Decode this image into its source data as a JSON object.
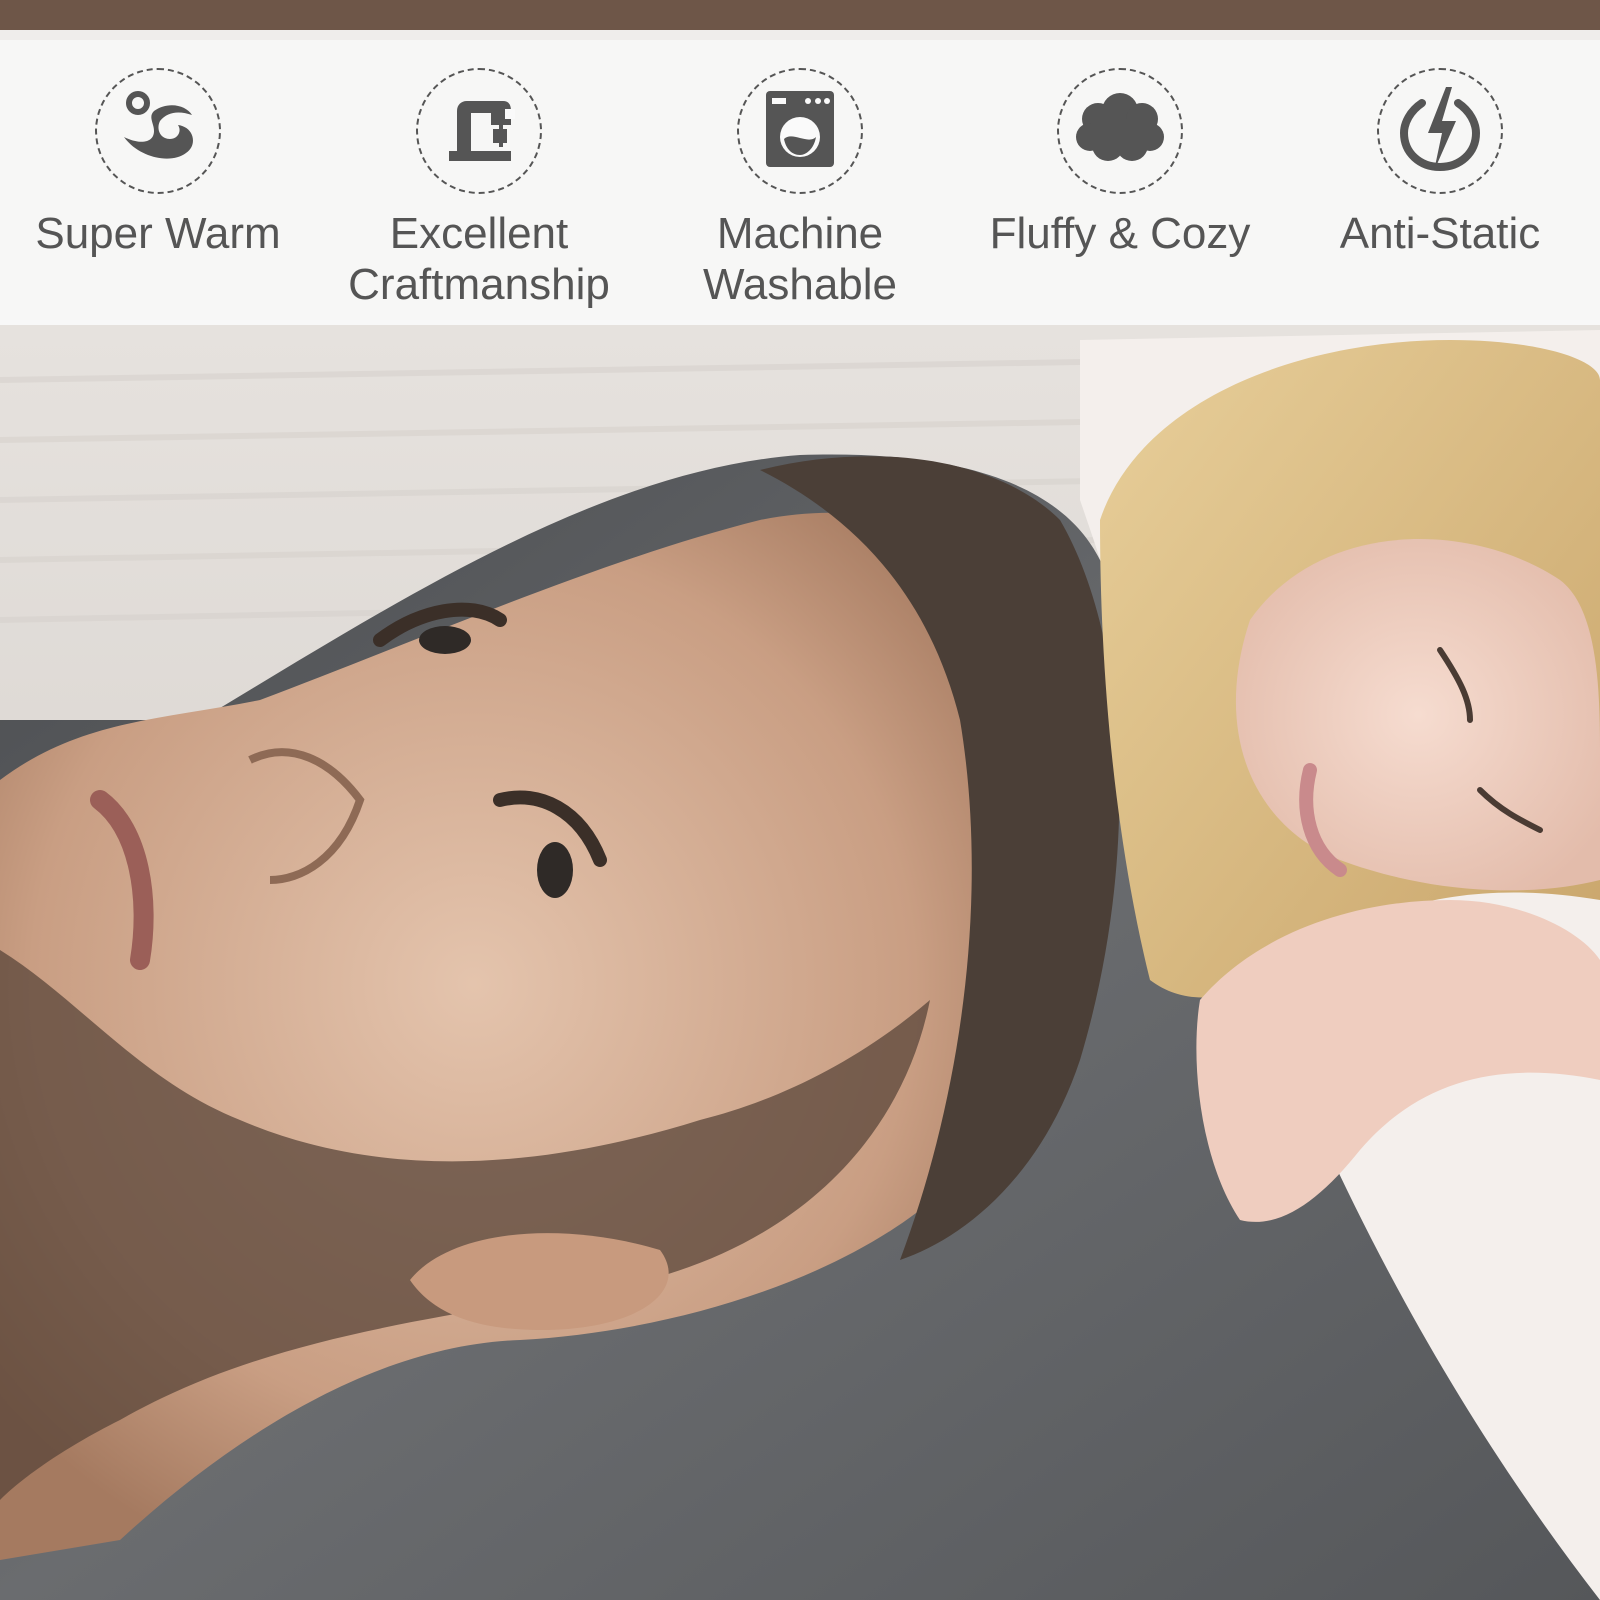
{
  "colors": {
    "icon_gray": "#555555",
    "banner_bg": "#fafafa",
    "blanket_gray": "#5f6163",
    "pillow_white": "#f4efec"
  },
  "features": [
    {
      "icon": "warmth-wave-icon",
      "label_lines": [
        "Super Warm"
      ]
    },
    {
      "icon": "sewing-machine-icon",
      "label_lines": [
        "Excellent",
        "Craftmanship"
      ]
    },
    {
      "icon": "washing-machine-icon",
      "label_lines": [
        "Machine",
        "Washable"
      ]
    },
    {
      "icon": "cloud-icon",
      "label_lines": [
        "Fluffy & Cozy"
      ]
    },
    {
      "icon": "lightning-bolt-icon",
      "label_lines": [
        "Anti-Static"
      ]
    }
  ]
}
